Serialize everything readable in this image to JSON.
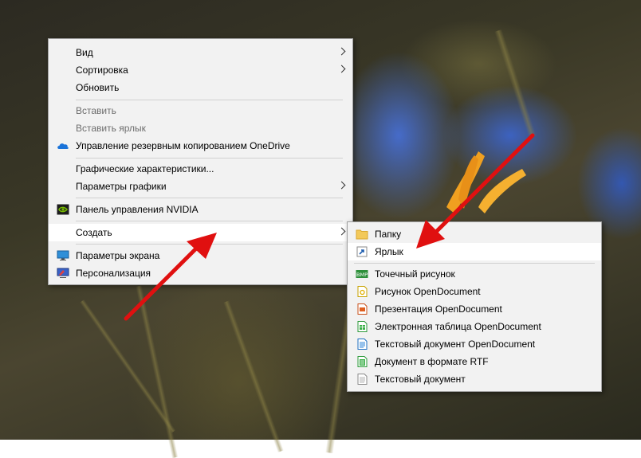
{
  "context_menu": {
    "items": [
      {
        "label": "Вид",
        "submenu": true
      },
      {
        "label": "Сортировка",
        "submenu": true
      },
      {
        "label": "Обновить"
      },
      {
        "label": "Вставить",
        "disabled": true
      },
      {
        "label": "Вставить ярлык",
        "disabled": true
      },
      {
        "label": "Управление резервным копированием OneDrive",
        "icon": "onedrive-cloud-icon"
      },
      {
        "label": "Графические характеристики..."
      },
      {
        "label": "Параметры графики",
        "submenu": true
      },
      {
        "label": "Панель управления NVIDIA",
        "icon": "nvidia-icon"
      },
      {
        "label": "Создать",
        "submenu": true,
        "highlighted": true
      },
      {
        "label": "Параметры экрана",
        "icon": "display-settings-icon"
      },
      {
        "label": "Персонализация",
        "icon": "personalization-icon"
      }
    ]
  },
  "create_submenu": {
    "items": [
      {
        "label": "Папку",
        "icon": "folder-icon"
      },
      {
        "label": "Ярлык",
        "icon": "shortcut-icon",
        "highlighted": true
      },
      {
        "label": "Точечный рисунок",
        "icon": "bmp-icon",
        "icon_text": "BMP"
      },
      {
        "label": "Рисунок OpenDocument",
        "icon": "odg-icon"
      },
      {
        "label": "Презентация OpenDocument",
        "icon": "odp-icon"
      },
      {
        "label": "Электронная таблица OpenDocument",
        "icon": "ods-icon"
      },
      {
        "label": "Текстовый документ OpenDocument",
        "icon": "odt-icon"
      },
      {
        "label": "Документ в формате RTF",
        "icon": "rtf-icon"
      },
      {
        "label": "Текстовый документ",
        "icon": "txt-icon"
      }
    ]
  },
  "colors": {
    "menu_bg": "#f2f2f2",
    "highlight": "#ffffff",
    "annotation_arrow": "#e01010"
  }
}
